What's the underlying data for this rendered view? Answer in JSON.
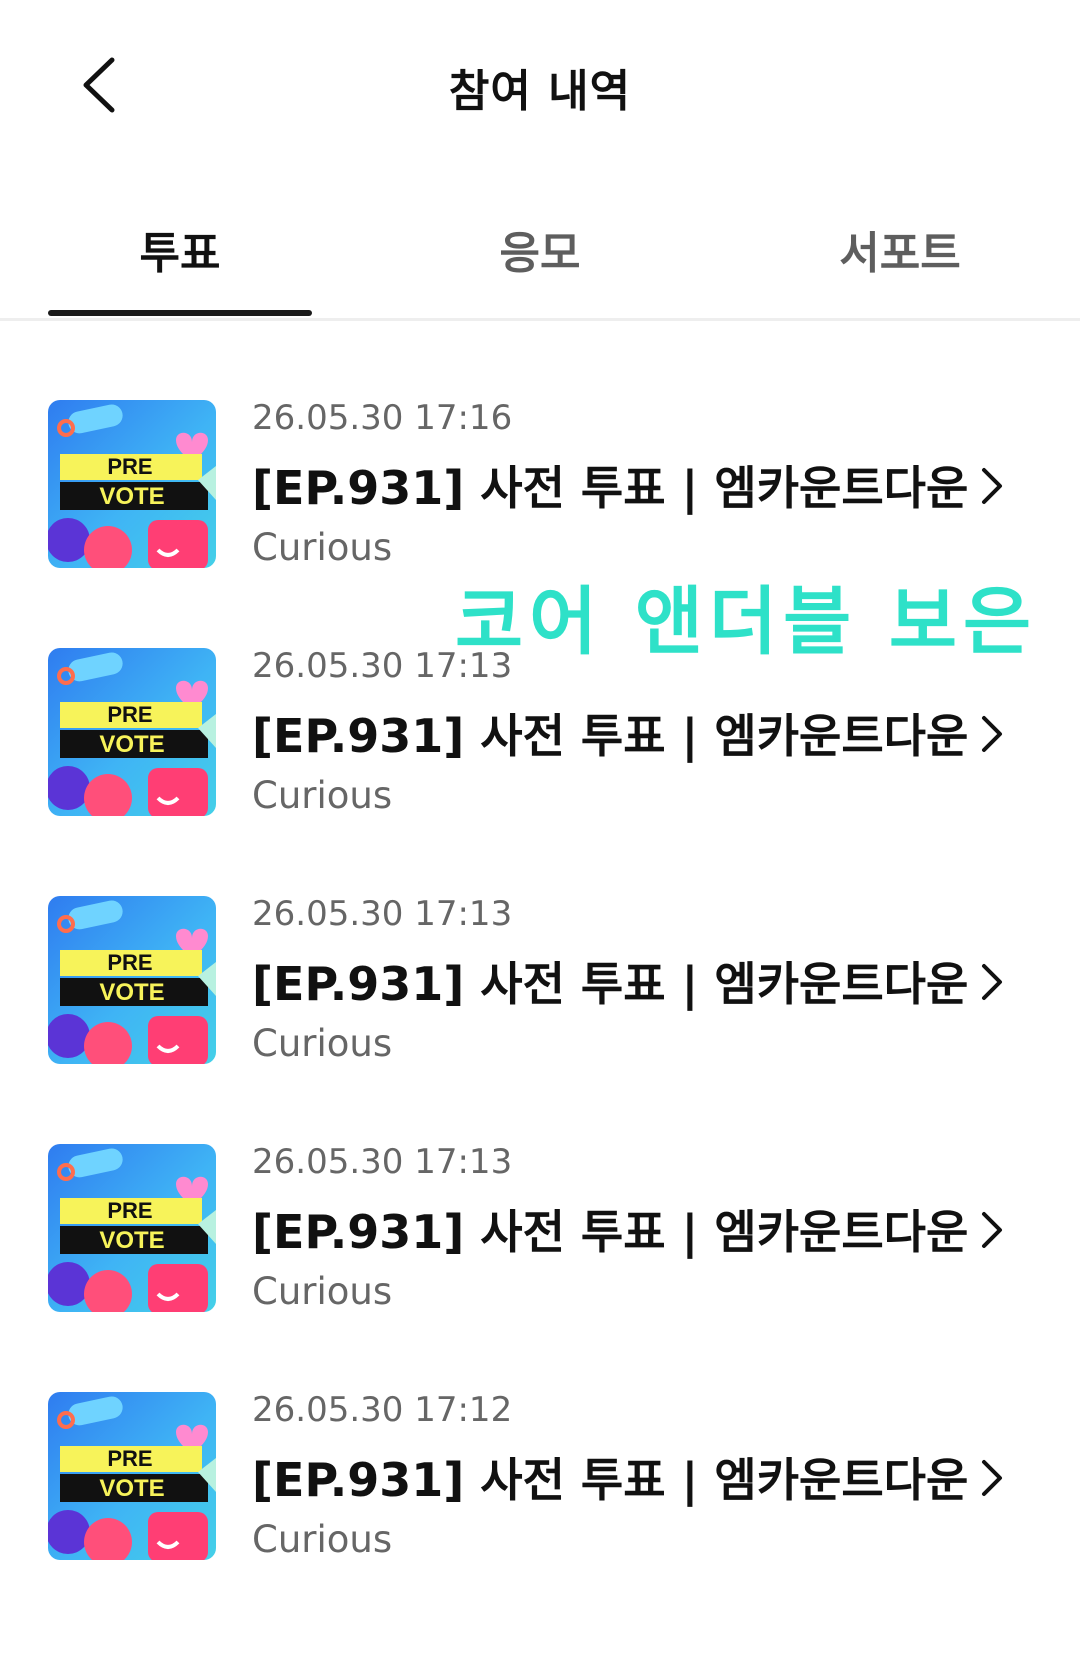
{
  "header": {
    "title": "참여 내역",
    "back_icon": "chevron-left-icon"
  },
  "tabs": [
    {
      "label": "투표",
      "active": true
    },
    {
      "label": "응모",
      "active": false
    },
    {
      "label": "서포트",
      "active": false
    }
  ],
  "items": [
    {
      "date": "26.05.30 17:16",
      "title": "[EP.931] 사전 투표 | 엠카운트다운",
      "subtitle": "Curious",
      "thumb_line1": "PRE",
      "thumb_line2": "VOTE"
    },
    {
      "date": "26.05.30 17:13",
      "title": "[EP.931] 사전 투표 | 엠카운트다운",
      "subtitle": "Curious",
      "thumb_line1": "PRE",
      "thumb_line2": "VOTE"
    },
    {
      "date": "26.05.30 17:13",
      "title": "[EP.931] 사전 투표 | 엠카운트다운",
      "subtitle": "Curious",
      "thumb_line1": "PRE",
      "thumb_line2": "VOTE"
    },
    {
      "date": "26.05.30 17:13",
      "title": "[EP.931] 사전 투표 | 엠카운트다운",
      "subtitle": "Curious",
      "thumb_line1": "PRE",
      "thumb_line2": "VOTE"
    },
    {
      "date": "26.05.30 17:12",
      "title": "[EP.931] 사전 투표 | 엠카운트다운",
      "subtitle": "Curious",
      "thumb_line1": "PRE",
      "thumb_line2": "VOTE"
    }
  ],
  "overlay_text": "코어 앤더블 보은",
  "colors": {
    "overlay": "#2ee1c8",
    "indicator": "#1a1a1a"
  }
}
